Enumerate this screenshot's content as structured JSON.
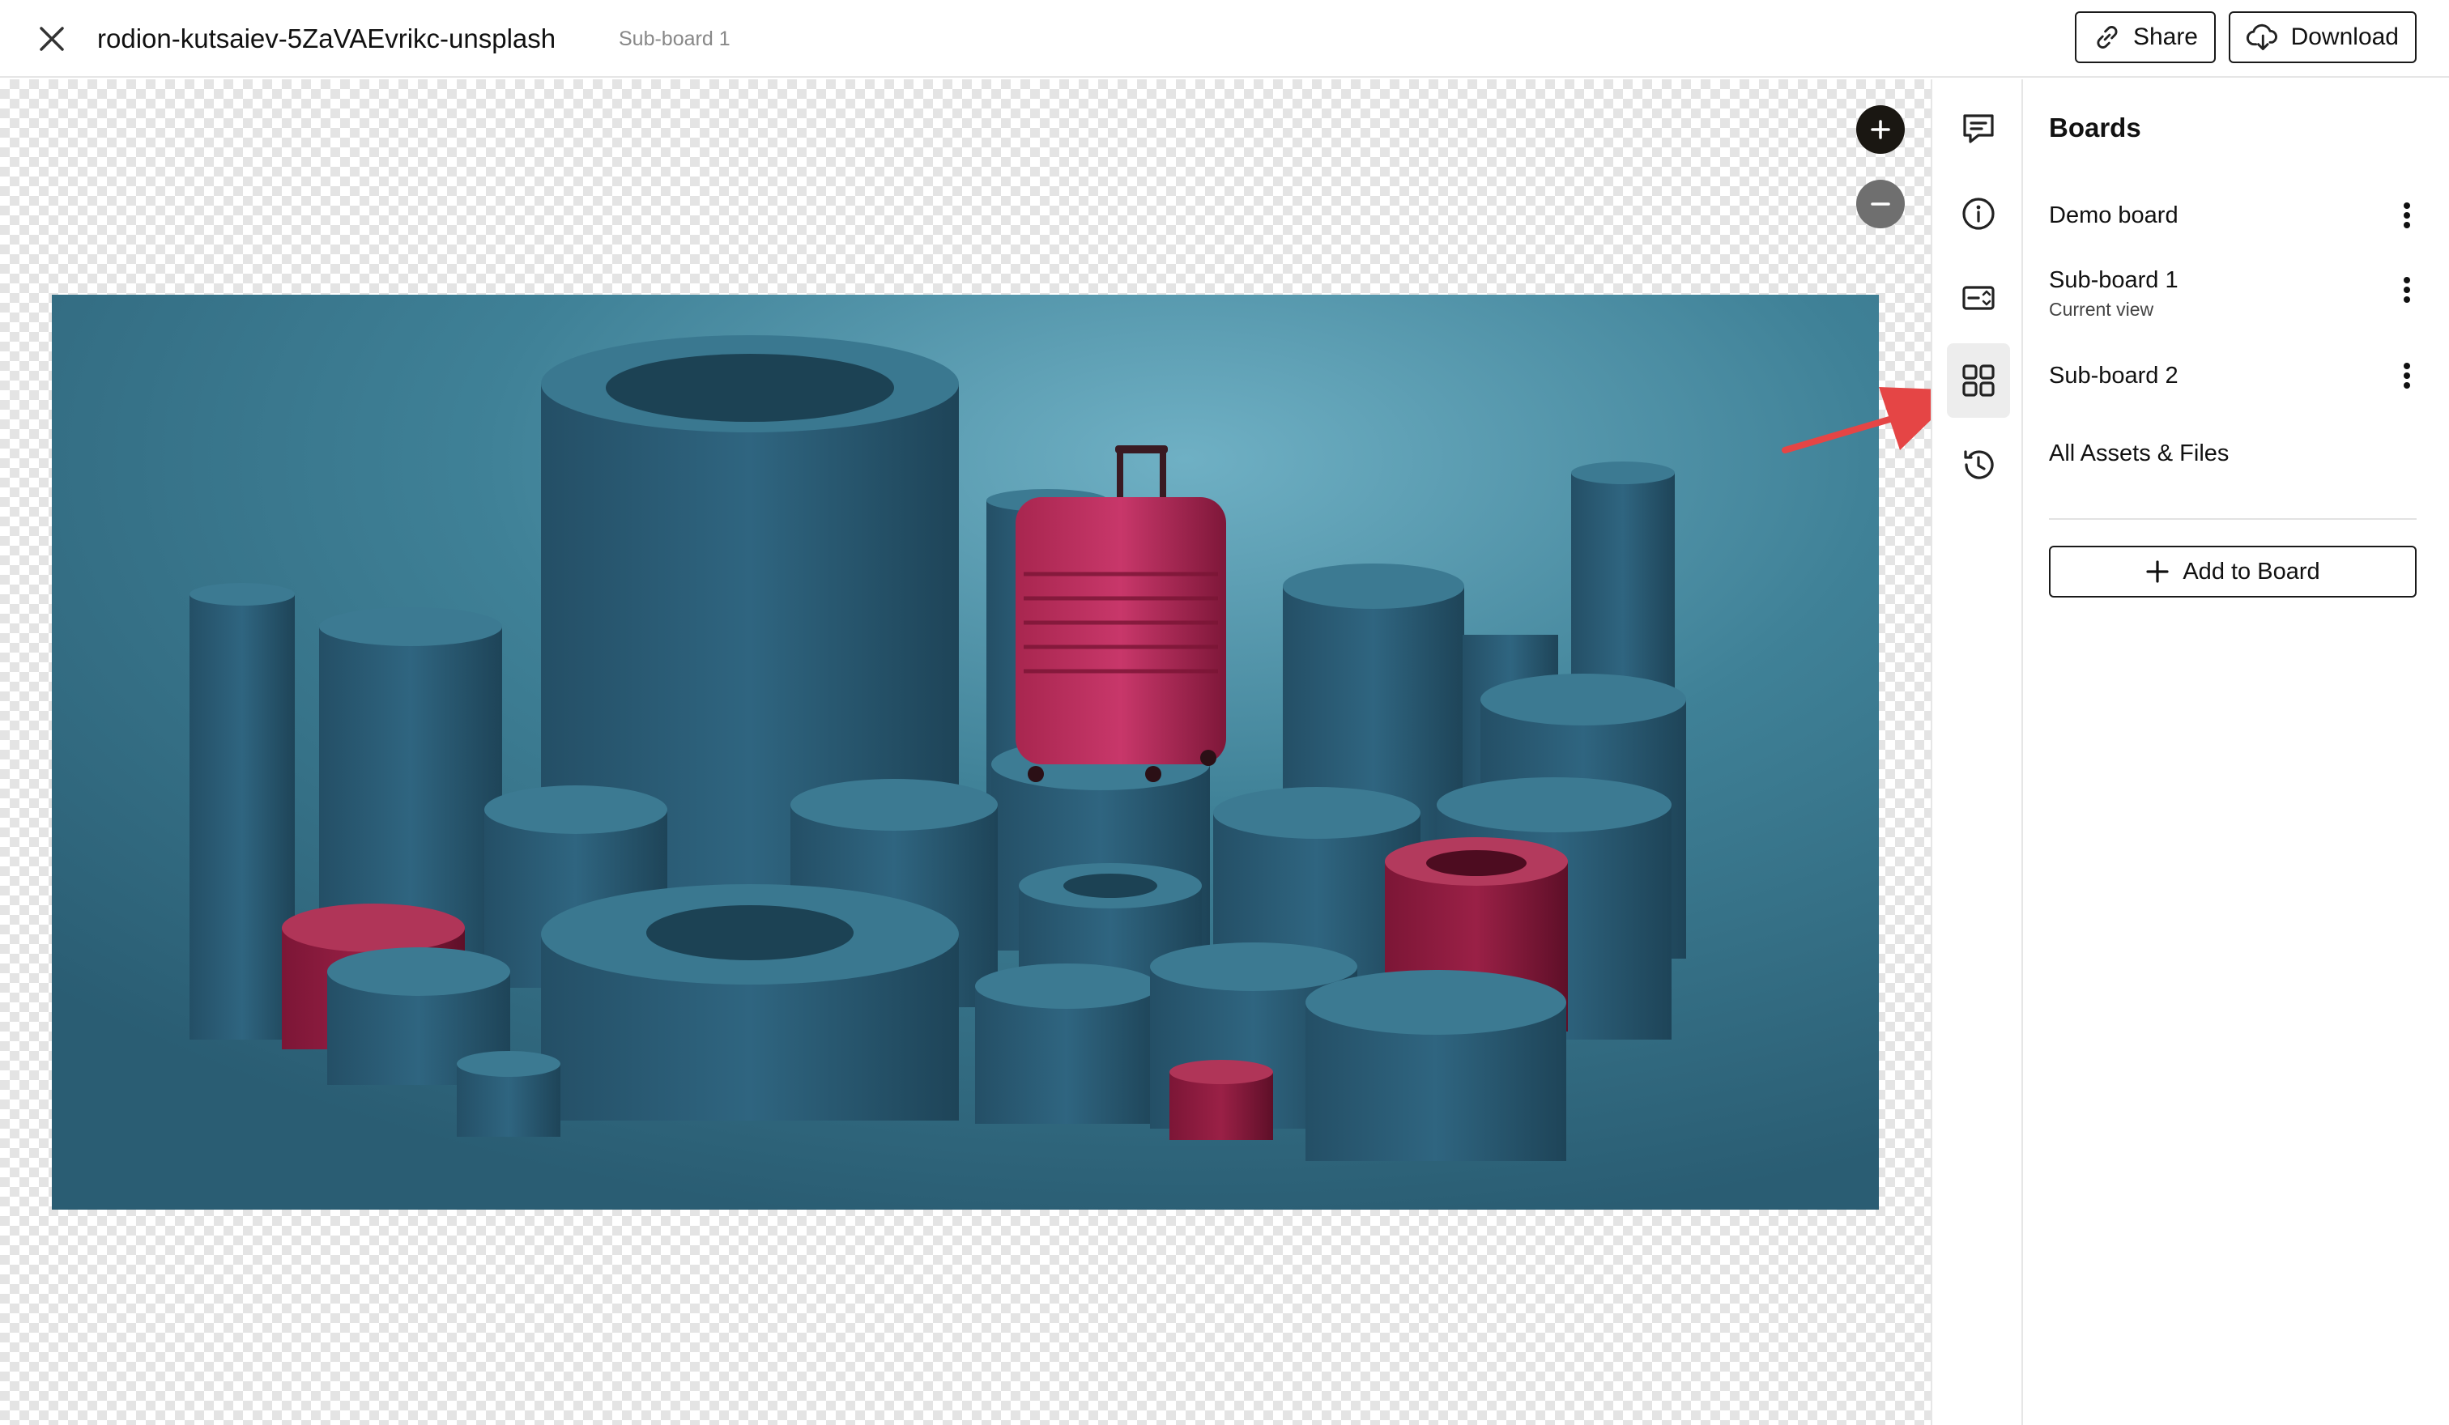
{
  "header": {
    "title": "rodion-kutsaiev-5ZaVAEvrikc-unsplash",
    "subtitle": "Sub-board 1",
    "share_label": "Share",
    "download_label": "Download",
    "close_icon": "close-icon"
  },
  "canvas": {
    "zoom_in_icon": "plus-icon",
    "zoom_out_icon": "minus-icon",
    "image_content": "suitcase-on-cylinders-photo"
  },
  "rail": {
    "icons": [
      "comment-icon",
      "info-icon",
      "compare-icon",
      "boards-grid-icon",
      "history-icon"
    ],
    "active": "boards-grid-icon"
  },
  "panel": {
    "title": "Boards",
    "boards": [
      {
        "name": "Demo board",
        "sub": ""
      },
      {
        "name": "Sub-board 1",
        "sub": "Current view"
      },
      {
        "name": "Sub-board 2",
        "sub": ""
      }
    ],
    "all_assets_label": "All Assets & Files",
    "add_to_board_label": "Add to Board"
  },
  "colors": {
    "photo_background": "#3f8197",
    "cylinder": "#2d5f78",
    "accent_red": "#9a2046",
    "annotation_arrow": "#e54545"
  }
}
